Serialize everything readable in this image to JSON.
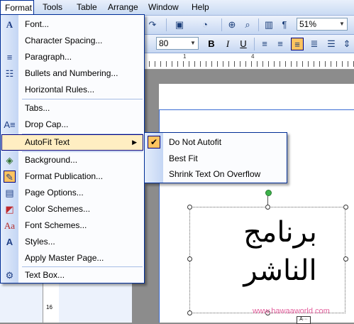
{
  "menubar": {
    "items": [
      {
        "label": "Format"
      },
      {
        "label": "Tools"
      },
      {
        "label": "Table"
      },
      {
        "label": "Arrange"
      },
      {
        "label": "Window"
      },
      {
        "label": "Help"
      }
    ]
  },
  "toolbar": {
    "zoom_value": "51%",
    "font_size_value": "80"
  },
  "ruler": {
    "label_left": "1",
    "label_mid": "4",
    "vertical_label": "16"
  },
  "format_menu": {
    "items": [
      {
        "label": "Font...",
        "icon": "font-icon"
      },
      {
        "label": "Character Spacing...",
        "icon": ""
      },
      {
        "label": "Paragraph...",
        "icon": "paragraph-icon"
      },
      {
        "label": "Bullets and Numbering...",
        "icon": "bullets-icon"
      },
      {
        "label": "Horizontal Rules...",
        "icon": ""
      },
      {
        "label": "Tabs...",
        "icon": ""
      },
      {
        "label": "Drop Cap...",
        "icon": "drop-cap-icon"
      },
      {
        "label": "AutoFit Text",
        "icon": ""
      },
      {
        "label": "Background...",
        "icon": "background-icon"
      },
      {
        "label": "Format Publication...",
        "icon": "format-publication-icon"
      },
      {
        "label": "Page Options...",
        "icon": "page-options-icon"
      },
      {
        "label": "Color Schemes...",
        "icon": "color-schemes-icon"
      },
      {
        "label": "Font Schemes...",
        "icon": "font-schemes-icon"
      },
      {
        "label": "Styles...",
        "icon": "styles-icon"
      },
      {
        "label": "Apply Master Page...",
        "icon": ""
      },
      {
        "label": "Text Box...",
        "icon": "text-box-icon"
      }
    ]
  },
  "autofit_submenu": {
    "items": [
      {
        "label": "Do Not Autofit",
        "checked": true
      },
      {
        "label": "Best Fit",
        "checked": false
      },
      {
        "label": "Shrink Text On Overflow",
        "checked": false
      }
    ]
  },
  "document": {
    "line1": "برنامج",
    "line2": "الناشر",
    "watermark": "www.hawaaworld.com"
  },
  "colors": {
    "menu_border": "#002d96",
    "highlight": "#ffeec2",
    "check_bg": "#ffc45f",
    "margin_guide": "#3a6cd4",
    "watermark": "#e3609d"
  }
}
